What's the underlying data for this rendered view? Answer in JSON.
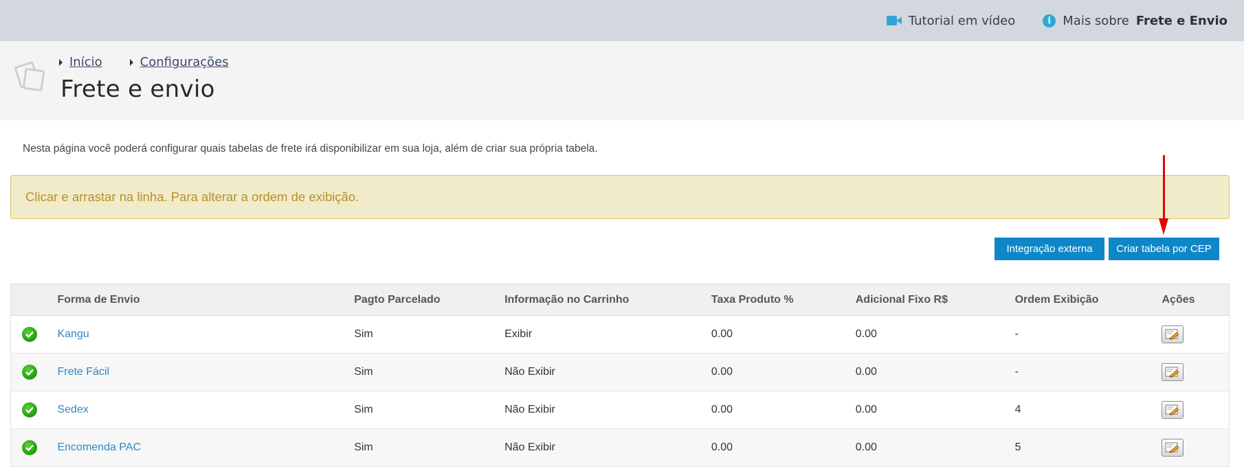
{
  "topbar": {
    "tutorial_label": "Tutorial em vídeo",
    "more_prefix": "Mais sobre",
    "more_subject": "Frete e Envio",
    "icons": [
      "video-camera-icon",
      "info-icon"
    ],
    "accent_color": "#2fa7d6"
  },
  "breadcrumb": {
    "items": [
      {
        "label": "Início"
      },
      {
        "label": "Configurações"
      }
    ]
  },
  "page": {
    "title": "Frete e envio",
    "intro": "Nesta página você poderá configurar quais tabelas de frete irá disponibilizar em sua loja, além de criar sua própria tabela."
  },
  "alert": {
    "text": "Clicar e arrastar na linha. Para alterar a ordem de exibição."
  },
  "actions": {
    "external_label": "Integração externa",
    "create_cep_label": "Criar tabela por CEP",
    "button_color": "#0e87c9"
  },
  "table": {
    "headers": {
      "status": "",
      "forma": "Forma de Envio",
      "parcelado": "Pagto Parcelado",
      "info": "Informação no Carrinho",
      "taxa": "Taxa Produto %",
      "adicional": "Adicional Fixo R$",
      "ordem": "Ordem Exibição",
      "acoes": "Ações"
    },
    "rows": [
      {
        "forma": "Kangu",
        "parcelado": "Sim",
        "info": "Exibir",
        "taxa": "0.00",
        "adicional": "0.00",
        "ordem": "-"
      },
      {
        "forma": "Frete Fácil",
        "parcelado": "Sim",
        "info": "Não Exibir",
        "taxa": "0.00",
        "adicional": "0.00",
        "ordem": "-"
      },
      {
        "forma": "Sedex",
        "parcelado": "Sim",
        "info": "Não Exibir",
        "taxa": "0.00",
        "adicional": "0.00",
        "ordem": "4"
      },
      {
        "forma": "Encomenda PAC",
        "parcelado": "Sim",
        "info": "Não Exibir",
        "taxa": "0.00",
        "adicional": "0.00",
        "ordem": "5"
      }
    ],
    "status_icon": "check-circle-icon",
    "action_icon": "edit-icon"
  }
}
